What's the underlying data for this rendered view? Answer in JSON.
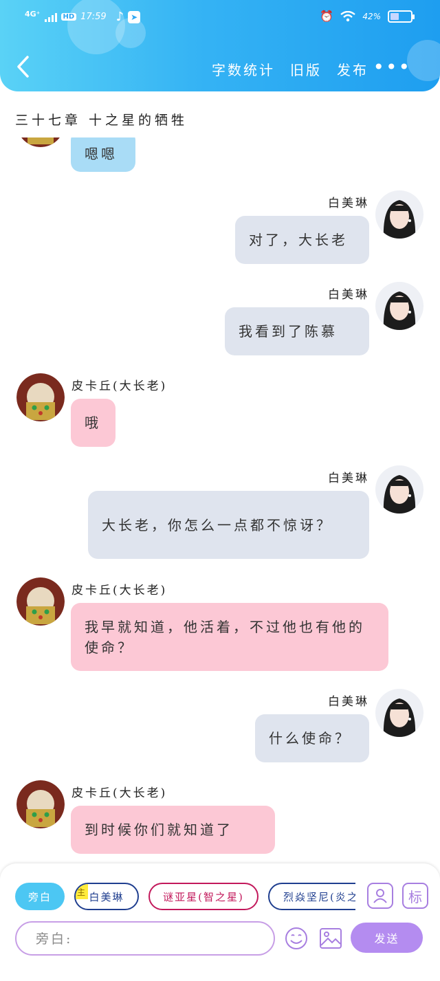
{
  "status_bar": {
    "network": "4G⁺",
    "hd_badge": "HD",
    "time": "17:59",
    "battery_percent": "42%",
    "battery_level": 0.42,
    "app_icons": [
      "tiktok-icon",
      "telegram-icon"
    ],
    "right_icons": [
      "alarm-icon",
      "wifi-icon",
      "battery-icon"
    ]
  },
  "header": {
    "actions": [
      "字数统计",
      "旧版",
      "发布"
    ],
    "more": "•••",
    "gradient": [
      "#5ad2f6",
      "#1e9ef0"
    ]
  },
  "chapter_title": "三十七章 十之星的牺牲",
  "messages": [
    {
      "side": "left",
      "name": "",
      "text": "嗯嗯",
      "style": "blue"
    },
    {
      "side": "right",
      "name": "白美琳",
      "text": "对了，大长老"
    },
    {
      "side": "right",
      "name": "白美琳",
      "text": "我看到了陈慕"
    },
    {
      "side": "left",
      "name": "皮卡丘(大长老)",
      "text": "哦"
    },
    {
      "side": "right",
      "name": "白美琳",
      "text": "大长老，你怎么一点都不惊讶？"
    },
    {
      "side": "left",
      "name": "皮卡丘(大长老)",
      "text": "我早就知道，他活着，不过他也有他的使命？"
    },
    {
      "side": "right",
      "name": "白美琳",
      "text": "什么使命？"
    },
    {
      "side": "left",
      "name": "皮卡丘(大长老)",
      "text": "到时候你们就知道了"
    }
  ],
  "composer": {
    "roles": [
      {
        "label": "旁白",
        "tag": ""
      },
      {
        "label": "白美琳",
        "tag": "主"
      },
      {
        "label": "谜亚星(智之星)",
        "tag": ""
      },
      {
        "label": "烈焱坚尼(炎之星)",
        "tag": ""
      }
    ],
    "mark_label": "标",
    "input_placeholder": "旁白:",
    "input_value": "",
    "send_label": "发送"
  },
  "colors": {
    "bubble_right": "#dfe4ee",
    "bubble_left": "#fcc8d5",
    "bubble_blue": "#a9dcf6",
    "accent_purple": "#b48cf0",
    "chip_blue": "#4cc7f3"
  }
}
